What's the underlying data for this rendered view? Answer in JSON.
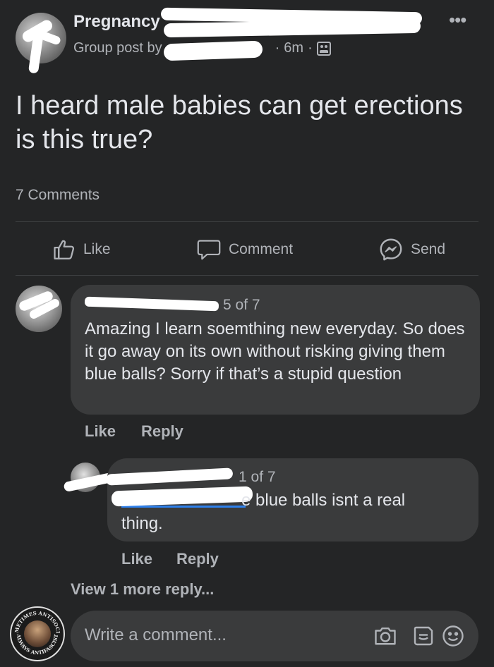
{
  "post": {
    "group_name": "Pregnancy",
    "meta_prefix": "Group post by",
    "time": "6m",
    "separator": "·",
    "more": "•••",
    "text": "I heard male babies can get erections is this true?",
    "comment_count": "7 Comments"
  },
  "actions": {
    "like": "Like",
    "comment": "Comment",
    "send": "Send"
  },
  "comments": [
    {
      "position": "5 of 7",
      "text": "Amazing I learn soemthing new everyday. So does it go away on its own without risking giving them blue balls? Sorry if that’s a stupid question",
      "like": "Like",
      "reply": "Reply"
    },
    {
      "position": "1 of 7",
      "text_line1": "e blue balls isnt a real",
      "text_line2": "thing.",
      "like": "Like",
      "reply": "Reply"
    }
  ],
  "view_more": "View 1 more reply...",
  "composer": {
    "placeholder": "Write a comment..."
  },
  "profile_badge": {
    "top_text": "SOMETIMES ANTISOCIAL",
    "bottom_text": "ALWAYS ANTIFASCIST"
  },
  "icons": [
    "more-icon",
    "group-icon",
    "like-icon",
    "comment-icon",
    "messenger-icon",
    "camera-icon",
    "gif-icon",
    "emoji-icon"
  ],
  "colors": {
    "background": "#242526",
    "bubble": "#3a3b3c",
    "text": "#e4e6eb",
    "secondary": "#b0b3b8",
    "link": "#2d88ff"
  }
}
